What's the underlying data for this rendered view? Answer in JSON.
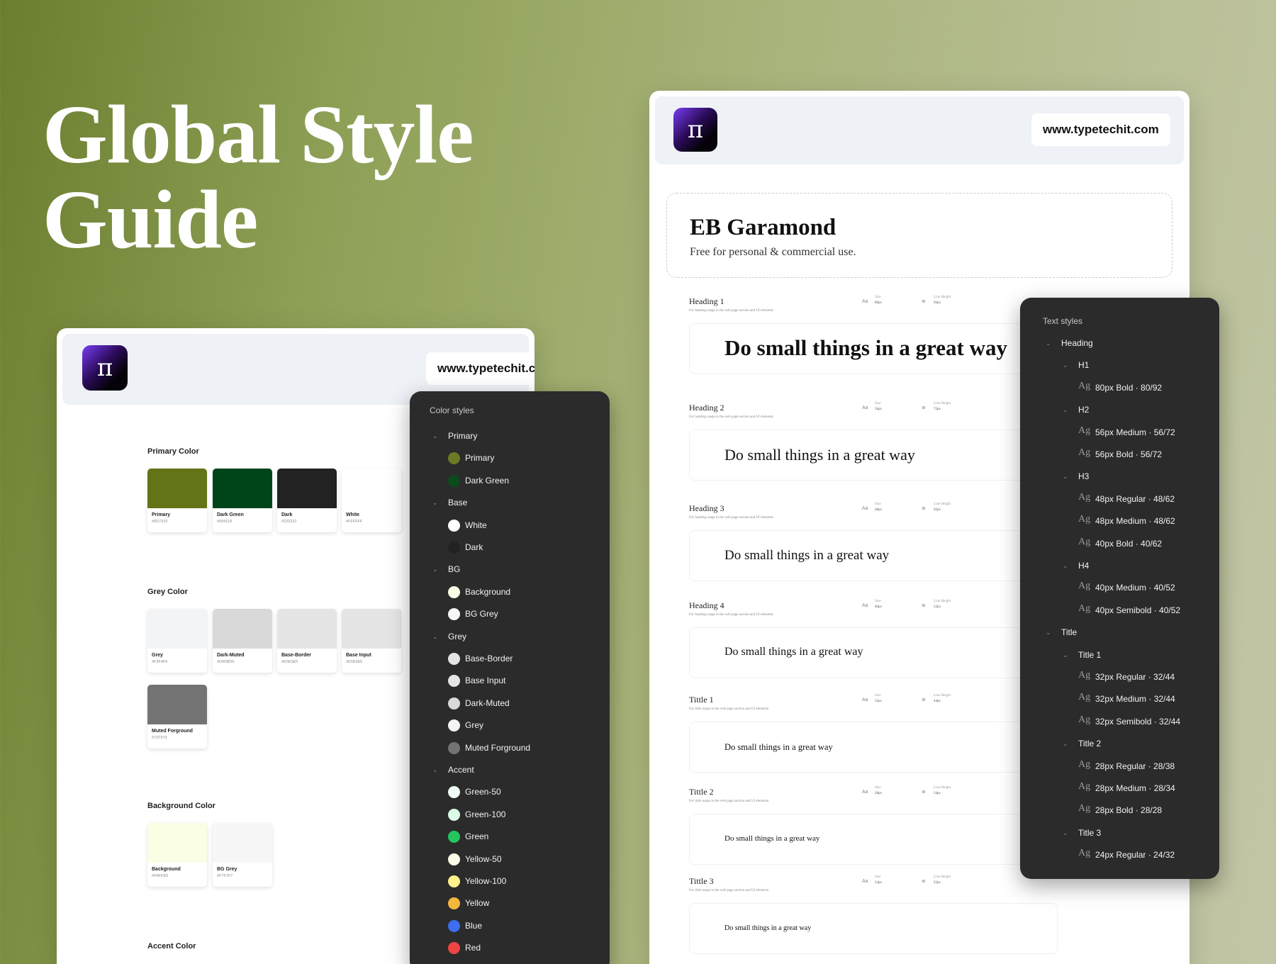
{
  "hero": {
    "line1": "Global Style",
    "line2": "Guide"
  },
  "brand": {
    "logo_glyph": "π",
    "url": "www.typetechit.com"
  },
  "left_card": {
    "sections": {
      "primary": "Primary Color",
      "grey": "Grey Color",
      "background": "Background Color",
      "accent": "Accent Color"
    },
    "primary_swatches": [
      {
        "name": "Primary",
        "hex": "#6D7315",
        "color": "#637318"
      },
      {
        "name": "Dark Green",
        "hex": "#004118",
        "color": "#00451a"
      },
      {
        "name": "Dark",
        "hex": "#222222",
        "color": "#222222"
      },
      {
        "name": "White",
        "hex": "#FFFFFF",
        "color": "#ffffff"
      }
    ],
    "grey_swatches": [
      {
        "name": "Grey",
        "hex": "#F3F4F6",
        "color": "#f3f4f6"
      },
      {
        "name": "Dark-Muted",
        "hex": "#D9D8D9",
        "color": "#d9d9d9"
      },
      {
        "name": "Base-Border",
        "hex": "#E5E5E5",
        "color": "#e5e5e5"
      },
      {
        "name": "Base Input",
        "hex": "#E5E5E5",
        "color": "#e5e5e5"
      },
      {
        "name": "Muted Forground",
        "hex": "#737373",
        "color": "#737373"
      }
    ],
    "bg_swatches": [
      {
        "name": "Background",
        "hex": "#FAFFE5",
        "color": "#fafee5"
      },
      {
        "name": "BG Grey",
        "hex": "#F7F7F7",
        "color": "#f7f7f7"
      }
    ]
  },
  "color_panel": {
    "title": "Color styles",
    "groups": [
      {
        "name": "Primary",
        "items": [
          {
            "name": "Primary",
            "color": "#6b7a24"
          },
          {
            "name": "Dark Green",
            "color": "#0b4a1c"
          }
        ]
      },
      {
        "name": "Base",
        "items": [
          {
            "name": "White",
            "color": "#ffffff"
          },
          {
            "name": "Dark",
            "color": "#222222"
          }
        ]
      },
      {
        "name": "BG",
        "items": [
          {
            "name": "Background",
            "color": "#fafee5"
          },
          {
            "name": "BG Grey",
            "color": "#f7f7f7"
          }
        ]
      },
      {
        "name": "Grey",
        "items": [
          {
            "name": "Base-Border",
            "color": "#e5e5e5"
          },
          {
            "name": "Base Input",
            "color": "#e5e5e5"
          },
          {
            "name": "Dark-Muted",
            "color": "#d9d9d9"
          },
          {
            "name": "Grey",
            "color": "#f3f4f6"
          },
          {
            "name": "Muted Forground",
            "color": "#737373"
          }
        ]
      },
      {
        "name": "Accent",
        "items": [
          {
            "name": "Green-50",
            "color": "#f0fdf4"
          },
          {
            "name": "Green-100",
            "color": "#dcfce7"
          },
          {
            "name": "Green",
            "color": "#22c55e"
          },
          {
            "name": "Yellow-50",
            "color": "#fefce8"
          },
          {
            "name": "Yellow-100",
            "color": "#fef08a"
          },
          {
            "name": "Yellow",
            "color": "#f5b73b"
          },
          {
            "name": "Blue",
            "color": "#3b6ef0"
          },
          {
            "name": "Red",
            "color": "#ef4444"
          }
        ]
      }
    ]
  },
  "font_card": {
    "font_name": "EB Garamond",
    "font_note": "Free for personal & commercial use.",
    "size_label": "Size",
    "lh_label": "Line Height",
    "heading_desc": "For heading usage in the web page section and UI elements",
    "title_desc": "For tittle usage in the web page section and UI elements",
    "sample_text": "Do small things in a great way",
    "rows": [
      {
        "label": "Heading 1",
        "size": "80px",
        "lh": "92px"
      },
      {
        "label": "Heading 2",
        "size": "56px",
        "lh": "72px"
      },
      {
        "label": "Heading 3",
        "size": "48px",
        "lh": "62px"
      },
      {
        "label": "Heading 4",
        "size": "40px",
        "lh": "52px"
      },
      {
        "label": "Tittle 1",
        "size": "32px",
        "lh": "44px"
      },
      {
        "label": "Tittle 2",
        "size": "28px",
        "lh": "34px"
      },
      {
        "label": "Tittle 3",
        "size": "24px",
        "lh": "32px"
      }
    ]
  },
  "text_panel": {
    "title": "Text styles",
    "ag": "Ag",
    "heading_group": "Heading",
    "title_group": "Title",
    "subgroups": [
      {
        "name": "H1",
        "styles": [
          "80px Bold · 80/92"
        ]
      },
      {
        "name": "H2",
        "styles": [
          "56px Medium · 56/72",
          "56px Bold · 56/72"
        ]
      },
      {
        "name": "H3",
        "styles": [
          "48px Regular · 48/62",
          "48px Medium · 48/62",
          "40px Bold · 40/62"
        ]
      },
      {
        "name": "H4",
        "styles": [
          "40px Medium · 40/52",
          "40px Semibold · 40/52"
        ]
      },
      {
        "name": "Title 1",
        "styles": [
          "32px Regular · 32/44",
          "32px Medium · 32/44",
          "32px Semibold · 32/44"
        ]
      },
      {
        "name": "Title 2",
        "styles": [
          "28px Regular · 28/38",
          "28px Medium · 28/34",
          "28px Bold · 28/28"
        ]
      },
      {
        "name": "Title 3",
        "styles": [
          "24px Regular · 24/32"
        ]
      }
    ]
  }
}
